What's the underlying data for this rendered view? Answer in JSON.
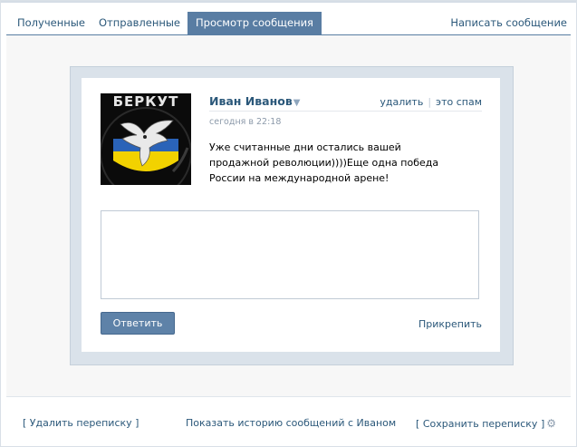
{
  "tabs": {
    "received": "Полученные",
    "sent": "Отправленные",
    "view": "Просмотр сообщения",
    "compose": "Написать сообщение"
  },
  "message": {
    "author": "Иван Иванов",
    "author_arrow": "▼",
    "date": "сегодня в 22:18",
    "delete": "удалить",
    "separator": "|",
    "spam": "это спам",
    "text": "Уже считанные дни остались вашей продажной революции))))Еще одна победа России на международной арене!",
    "avatar_caption": "БЕРКУТ"
  },
  "reply": {
    "value": "",
    "button": "Ответить",
    "attach": "Прикрепить"
  },
  "footer": {
    "delete_thread": "[ Удалить переписку ]",
    "history": "Показать историю сообщений с Иваном",
    "save_thread": "[ Сохранить переписку ]",
    "settings_icon": "gear-icon"
  },
  "colors": {
    "accent": "#597da3",
    "link": "#2b587a",
    "button": "#5e82a8",
    "box_border": "#dae2ea"
  }
}
